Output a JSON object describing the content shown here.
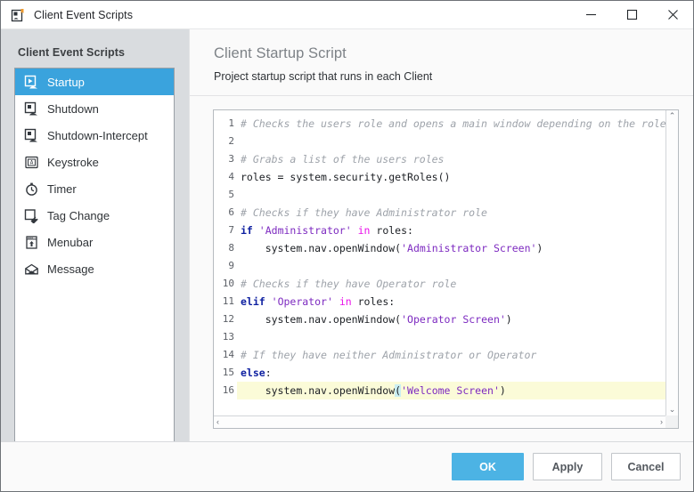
{
  "window": {
    "title": "Client Event Scripts",
    "icon": "script-document-icon",
    "controls": {
      "minimize": "minimize-icon",
      "maximize": "maximize-icon",
      "close": "close-icon"
    }
  },
  "sidebar": {
    "title": "Client Event Scripts",
    "items": [
      {
        "label": "Startup",
        "icon": "startup-icon",
        "selected": true
      },
      {
        "label": "Shutdown",
        "icon": "shutdown-icon",
        "selected": false
      },
      {
        "label": "Shutdown-Intercept",
        "icon": "shutdown-intercept-icon",
        "selected": false
      },
      {
        "label": "Keystroke",
        "icon": "keystroke-icon",
        "selected": false
      },
      {
        "label": "Timer",
        "icon": "timer-clock-icon",
        "selected": false
      },
      {
        "label": "Tag Change",
        "icon": "tag-change-icon",
        "selected": false
      },
      {
        "label": "Menubar",
        "icon": "menubar-icon",
        "selected": false
      },
      {
        "label": "Message",
        "icon": "message-envelope-icon",
        "selected": false
      }
    ]
  },
  "panel": {
    "title": "Client Startup Script",
    "subtitle": "Project startup script that runs in each Client"
  },
  "editor": {
    "language": "python",
    "current_line": 16,
    "line_numbers": [
      "1",
      "2",
      "3",
      "4",
      "5",
      "6",
      "7",
      "8",
      "9",
      "10",
      "11",
      "12",
      "13",
      "14",
      "15",
      "16"
    ],
    "lines": [
      {
        "n": 1,
        "text": "# Checks the users role and opens a main window depending on the role"
      },
      {
        "n": 2,
        "text": ""
      },
      {
        "n": 3,
        "text": "# Grabs a list of the users roles"
      },
      {
        "n": 4,
        "text": "roles = system.security.getRoles()"
      },
      {
        "n": 5,
        "text": ""
      },
      {
        "n": 6,
        "text": "# Checks if they have Administrator role"
      },
      {
        "n": 7,
        "text": "if 'Administrator' in roles:"
      },
      {
        "n": 8,
        "text": "    system.nav.openWindow('Administrator Screen')"
      },
      {
        "n": 9,
        "text": ""
      },
      {
        "n": 10,
        "text": "# Checks if they have Operator role"
      },
      {
        "n": 11,
        "text": "elif 'Operator' in roles:"
      },
      {
        "n": 12,
        "text": "    system.nav.openWindow('Operator Screen')"
      },
      {
        "n": 13,
        "text": ""
      },
      {
        "n": 14,
        "text": "# If they have neither Administrator or Operator"
      },
      {
        "n": 15,
        "text": "else:"
      },
      {
        "n": 16,
        "text": "    system.nav.openWindow('Welcome Screen')"
      }
    ],
    "scrollbars": {
      "vertical_up": "⌃",
      "vertical_down": "⌄",
      "horizontal_left": "‹",
      "horizontal_right": "›"
    }
  },
  "footer": {
    "ok": "OK",
    "apply": "Apply",
    "cancel": "Cancel"
  },
  "colors": {
    "accent": "#3aa3dd",
    "primary_button": "#4cb3e4",
    "sidebar_bg": "#d9dcdf",
    "current_line": "#fbfbd8",
    "comment": "#9ea3aa",
    "keyword": "#0d1fa0",
    "operator": "#e912e9",
    "string": "#7d2ac0"
  }
}
